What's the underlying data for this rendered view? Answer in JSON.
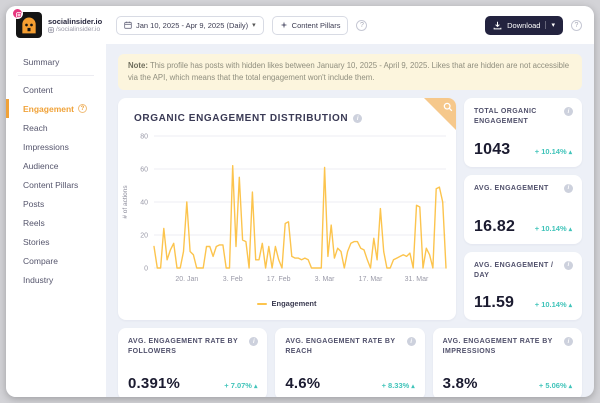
{
  "icons": {
    "help": "?",
    "caret_down": "▾",
    "trend_up": "▴",
    "info": "i"
  },
  "topbar": {
    "profile": {
      "name": "socialinsider.io",
      "handle": "/socialinsider.io"
    },
    "date_range": "Jan 10, 2025 - Apr 9, 2025 (Daily)",
    "content_pillars_label": "Content Pillars",
    "download_label": "Download"
  },
  "sidebar": {
    "items": [
      {
        "label": "Summary"
      },
      {
        "label": "Content"
      },
      {
        "label": "Engagement",
        "active": true
      },
      {
        "label": "Reach"
      },
      {
        "label": "Impressions"
      },
      {
        "label": "Audience"
      },
      {
        "label": "Content Pillars"
      },
      {
        "label": "Posts"
      },
      {
        "label": "Reels"
      },
      {
        "label": "Stories"
      },
      {
        "label": "Compare"
      },
      {
        "label": "Industry"
      }
    ]
  },
  "note": {
    "prefix": "Note:",
    "text": " This profile has posts with hidden likes between January 10, 2025 - April 9, 2025. Likes that are hidden are not accessible via the API, which means that the total engagement won't include them."
  },
  "chart_data": {
    "type": "line",
    "title": "ORGANIC ENGAGEMENT DISTRIBUTION",
    "xlabel": "",
    "ylabel": "# of actions",
    "ylim": [
      0,
      80
    ],
    "yticks": [
      0,
      20,
      40,
      60,
      80
    ],
    "x_range": "Jan 10, 2025 - Apr 9, 2025 (daily)",
    "xticks": [
      {
        "index": 10,
        "label": "20. Jan"
      },
      {
        "index": 24,
        "label": "3. Feb"
      },
      {
        "index": 38,
        "label": "17. Feb"
      },
      {
        "index": 52,
        "label": "3. Mar"
      },
      {
        "index": 66,
        "label": "17. Mar"
      },
      {
        "index": 80,
        "label": "31. Mar"
      }
    ],
    "grid": true,
    "legend_position": "bottom",
    "series": [
      {
        "name": "Engagement",
        "color": "#fcc44d",
        "values": [
          13,
          0,
          0,
          24,
          5,
          11,
          15,
          0,
          0,
          10,
          40,
          10,
          8,
          0,
          0,
          0,
          13,
          13,
          7,
          13,
          14,
          14,
          0,
          0,
          62,
          13,
          55,
          17,
          16,
          0,
          46,
          5,
          5,
          15,
          0,
          13,
          0,
          13,
          5,
          0,
          27,
          28,
          7,
          6,
          6,
          5,
          6,
          5,
          0,
          0,
          0,
          0,
          61,
          7,
          26,
          6,
          12,
          10,
          0,
          10,
          15,
          16,
          16,
          12,
          11,
          5,
          0,
          18,
          5,
          36,
          10,
          0,
          0,
          5,
          6,
          7,
          8,
          7,
          9,
          0,
          38,
          37,
          0,
          12,
          8,
          0,
          48,
          49,
          40,
          0
        ]
      }
    ]
  },
  "stats": [
    {
      "label": "TOTAL ORGANIC ENGAGEMENT",
      "value": "1043",
      "delta": "+ 10.14%",
      "direction": "up"
    },
    {
      "label": "AVG. ENGAGEMENT",
      "value": "16.82",
      "delta": "+ 10.14%",
      "direction": "up"
    },
    {
      "label": "AVG. ENGAGEMENT / DAY",
      "value": "11.59",
      "delta": "+ 10.14%",
      "direction": "up"
    },
    {
      "label": "AVG. ENGAGEMENT RATE BY FOLLOWERS",
      "value": "0.391%",
      "delta": "+ 7.07%",
      "direction": "up"
    },
    {
      "label": "AVG. ENGAGEMENT RATE BY REACH",
      "value": "4.6%",
      "delta": "+ 8.33%",
      "direction": "up"
    },
    {
      "label": "AVG. ENGAGEMENT RATE BY IMPRESSIONS",
      "value": "3.8%",
      "delta": "+ 5.06%",
      "direction": "up"
    }
  ],
  "colors": {
    "accent_orange": "#f0a238",
    "line_yellow": "#fcc44d",
    "teal_positive": "#41c4ba",
    "dark_button": "#23233f",
    "note_bg": "#fcf5dd",
    "corner_bg": "#f6c88b"
  }
}
